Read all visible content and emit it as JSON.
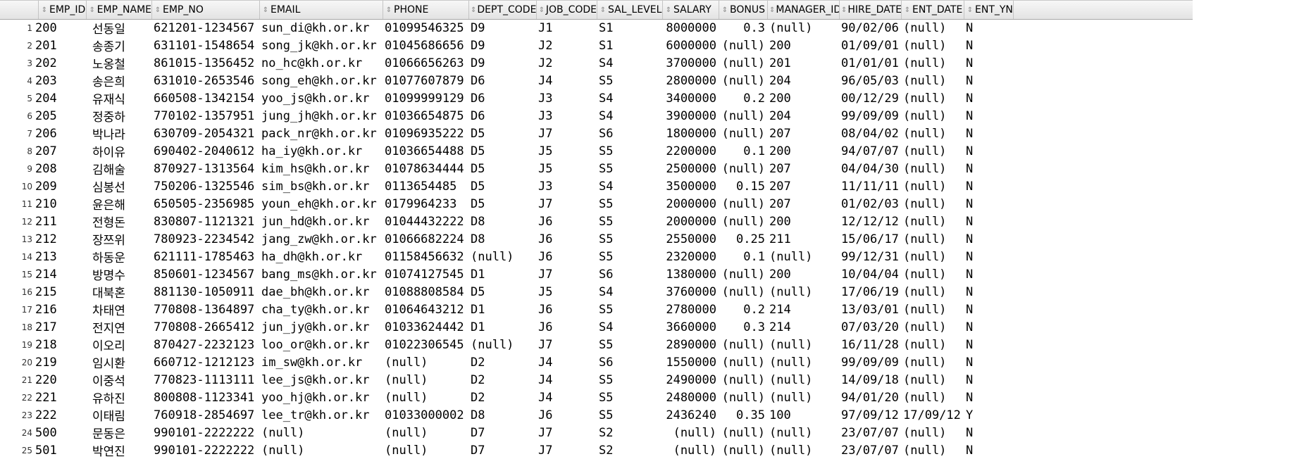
{
  "columns": [
    {
      "key": "emp_id",
      "label": "EMP_ID"
    },
    {
      "key": "emp_name",
      "label": "EMP_NAME"
    },
    {
      "key": "emp_no",
      "label": "EMP_NO"
    },
    {
      "key": "email",
      "label": "EMAIL"
    },
    {
      "key": "phone",
      "label": "PHONE"
    },
    {
      "key": "dept_code",
      "label": "DEPT_CODE"
    },
    {
      "key": "job_code",
      "label": "JOB_CODE"
    },
    {
      "key": "sal_level",
      "label": "SAL_LEVEL"
    },
    {
      "key": "salary",
      "label": "SALARY"
    },
    {
      "key": "bonus",
      "label": "BONUS"
    },
    {
      "key": "manager_id",
      "label": "MANAGER_ID"
    },
    {
      "key": "hire_date",
      "label": "HIRE_DATE"
    },
    {
      "key": "ent_date",
      "label": "ENT_DATE"
    },
    {
      "key": "ent_yn",
      "label": "ENT_YN"
    }
  ],
  "rows": [
    [
      "1",
      "200",
      "선동일",
      "621201-1234567",
      "sun_di@kh.or.kr",
      "01099546325",
      "D9",
      "J1",
      "S1",
      "8000000",
      "0.3",
      "(null)",
      "90/02/06",
      "(null)",
      "N"
    ],
    [
      "2",
      "201",
      "송종기",
      "631101-1548654",
      "song_jk@kh.or.kr",
      "01045686656",
      "D9",
      "J2",
      "S1",
      "6000000",
      "(null)",
      "200",
      "01/09/01",
      "(null)",
      "N"
    ],
    [
      "3",
      "202",
      "노옹철",
      "861015-1356452",
      "no_hc@kh.or.kr",
      "01066656263",
      "D9",
      "J2",
      "S4",
      "3700000",
      "(null)",
      "201",
      "01/01/01",
      "(null)",
      "N"
    ],
    [
      "4",
      "203",
      "송은희",
      "631010-2653546",
      "song_eh@kh.or.kr",
      "01077607879",
      "D6",
      "J4",
      "S5",
      "2800000",
      "(null)",
      "204",
      "96/05/03",
      "(null)",
      "N"
    ],
    [
      "5",
      "204",
      "유재식",
      "660508-1342154",
      "yoo_js@kh.or.kr",
      "01099999129",
      "D6",
      "J3",
      "S4",
      "3400000",
      "0.2",
      "200",
      "00/12/29",
      "(null)",
      "N"
    ],
    [
      "6",
      "205",
      "정중하",
      "770102-1357951",
      "jung_jh@kh.or.kr",
      "01036654875",
      "D6",
      "J3",
      "S4",
      "3900000",
      "(null)",
      "204",
      "99/09/09",
      "(null)",
      "N"
    ],
    [
      "7",
      "206",
      "박나라",
      "630709-2054321",
      "pack_nr@kh.or.kr",
      "01096935222",
      "D5",
      "J7",
      "S6",
      "1800000",
      "(null)",
      "207",
      "08/04/02",
      "(null)",
      "N"
    ],
    [
      "8",
      "207",
      "하이유",
      "690402-2040612",
      "ha_iy@kh.or.kr",
      "01036654488",
      "D5",
      "J5",
      "S5",
      "2200000",
      "0.1",
      "200",
      "94/07/07",
      "(null)",
      "N"
    ],
    [
      "9",
      "208",
      "김해술",
      "870927-1313564",
      "kim_hs@kh.or.kr",
      "01078634444",
      "D5",
      "J5",
      "S5",
      "2500000",
      "(null)",
      "207",
      "04/04/30",
      "(null)",
      "N"
    ],
    [
      "10",
      "209",
      "심봉선",
      "750206-1325546",
      "sim_bs@kh.or.kr",
      "0113654485",
      "D5",
      "J3",
      "S4",
      "3500000",
      "0.15",
      "207",
      "11/11/11",
      "(null)",
      "N"
    ],
    [
      "11",
      "210",
      "윤은해",
      "650505-2356985",
      "youn_eh@kh.or.kr",
      "0179964233",
      "D5",
      "J7",
      "S5",
      "2000000",
      "(null)",
      "207",
      "01/02/03",
      "(null)",
      "N"
    ],
    [
      "12",
      "211",
      "전형돈",
      "830807-1121321",
      "jun_hd@kh.or.kr",
      "01044432222",
      "D8",
      "J6",
      "S5",
      "2000000",
      "(null)",
      "200",
      "12/12/12",
      "(null)",
      "N"
    ],
    [
      "13",
      "212",
      "장쯔위",
      "780923-2234542",
      "jang_zw@kh.or.kr",
      "01066682224",
      "D8",
      "J6",
      "S5",
      "2550000",
      "0.25",
      "211",
      "15/06/17",
      "(null)",
      "N"
    ],
    [
      "14",
      "213",
      "하동운",
      "621111-1785463",
      "ha_dh@kh.or.kr",
      "01158456632",
      "(null)",
      "J6",
      "S5",
      "2320000",
      "0.1",
      "(null)",
      "99/12/31",
      "(null)",
      "N"
    ],
    [
      "15",
      "214",
      "방명수",
      "850601-1234567",
      "bang_ms@kh.or.kr",
      "01074127545",
      "D1",
      "J7",
      "S6",
      "1380000",
      "(null)",
      "200",
      "10/04/04",
      "(null)",
      "N"
    ],
    [
      "16",
      "215",
      "대북혼",
      "881130-1050911",
      "dae_bh@kh.or.kr",
      "01088808584",
      "D5",
      "J5",
      "S4",
      "3760000",
      "(null)",
      "(null)",
      "17/06/19",
      "(null)",
      "N"
    ],
    [
      "17",
      "216",
      "차태연",
      "770808-1364897",
      "cha_ty@kh.or.kr",
      "01064643212",
      "D1",
      "J6",
      "S5",
      "2780000",
      "0.2",
      "214",
      "13/03/01",
      "(null)",
      "N"
    ],
    [
      "18",
      "217",
      "전지연",
      "770808-2665412",
      "jun_jy@kh.or.kr",
      "01033624442",
      "D1",
      "J6",
      "S4",
      "3660000",
      "0.3",
      "214",
      "07/03/20",
      "(null)",
      "N"
    ],
    [
      "19",
      "218",
      "이오리",
      "870427-2232123",
      "loo_or@kh.or.kr",
      "01022306545",
      "(null)",
      "J7",
      "S5",
      "2890000",
      "(null)",
      "(null)",
      "16/11/28",
      "(null)",
      "N"
    ],
    [
      "20",
      "219",
      "임시환",
      "660712-1212123",
      "im_sw@kh.or.kr",
      "(null)",
      "D2",
      "J4",
      "S6",
      "1550000",
      "(null)",
      "(null)",
      "99/09/09",
      "(null)",
      "N"
    ],
    [
      "21",
      "220",
      "이중석",
      "770823-1113111",
      "lee_js@kh.or.kr",
      "(null)",
      "D2",
      "J4",
      "S5",
      "2490000",
      "(null)",
      "(null)",
      "14/09/18",
      "(null)",
      "N"
    ],
    [
      "22",
      "221",
      "유하진",
      "800808-1123341",
      "yoo_hj@kh.or.kr",
      "(null)",
      "D2",
      "J4",
      "S5",
      "2480000",
      "(null)",
      "(null)",
      "94/01/20",
      "(null)",
      "N"
    ],
    [
      "23",
      "222",
      "이태림",
      "760918-2854697",
      "lee_tr@kh.or.kr",
      "01033000002",
      "D8",
      "J6",
      "S5",
      "2436240",
      "0.35",
      "100",
      "97/09/12",
      "17/09/12",
      "Y"
    ],
    [
      "24",
      "500",
      "문동은",
      "990101-2222222",
      "(null)",
      "(null)",
      "D7",
      "J7",
      "S2",
      "(null)",
      "(null)",
      "(null)",
      "23/07/07",
      "(null)",
      "N"
    ],
    [
      "25",
      "501",
      "박연진",
      "990101-2222222",
      "(null)",
      "(null)",
      "D7",
      "J7",
      "S2",
      "(null)",
      "(null)",
      "(null)",
      "23/07/07",
      "(null)",
      "N"
    ]
  ]
}
